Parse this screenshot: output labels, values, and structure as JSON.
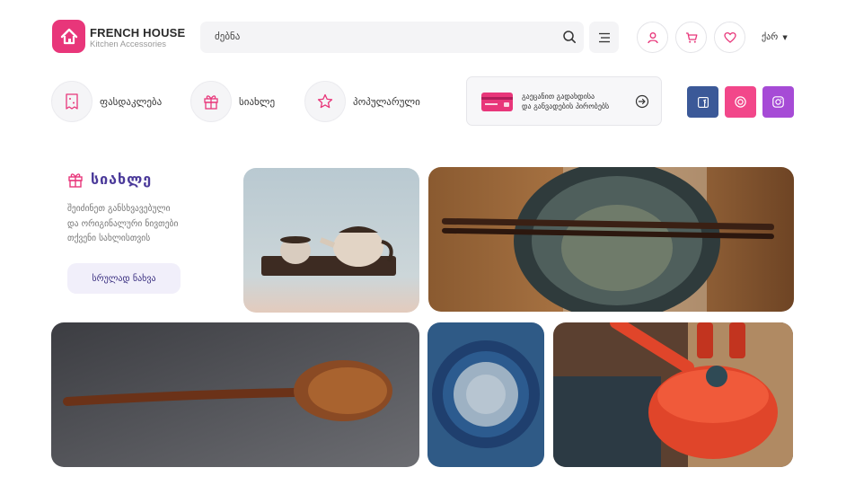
{
  "brand": {
    "name": "FRENCH HOUSE",
    "tagline": "Kitchen Accessories"
  },
  "search": {
    "placeholder": "ძებნა"
  },
  "header": {
    "language": "ქარ"
  },
  "categories": [
    {
      "label": "ფასდაკლება",
      "icon": "discount-tag-icon"
    },
    {
      "label": "სიახლე",
      "icon": "gift-icon"
    },
    {
      "label": "პოპულარული",
      "icon": "star-icon"
    }
  ],
  "promo": {
    "line1": "გაეცანით გადახდისა",
    "line2": "და განვადების პირობებს"
  },
  "social": [
    "facebook-icon",
    "foursquare-icon",
    "instagram-icon"
  ],
  "new_section": {
    "title": "სიახლე",
    "desc1": "შეიძინეთ განსხვავებული",
    "desc2": "და ორიგინალური ნივთები",
    "desc3": "თქვენი სახლისთვის",
    "button": "სრულად ნახვა"
  },
  "colors": {
    "accent": "#e8367a",
    "brand_purple": "#4b3a9a",
    "facebook": "#3b5998",
    "foursquare": "#f2478a",
    "instagram": "#a64bd6"
  }
}
